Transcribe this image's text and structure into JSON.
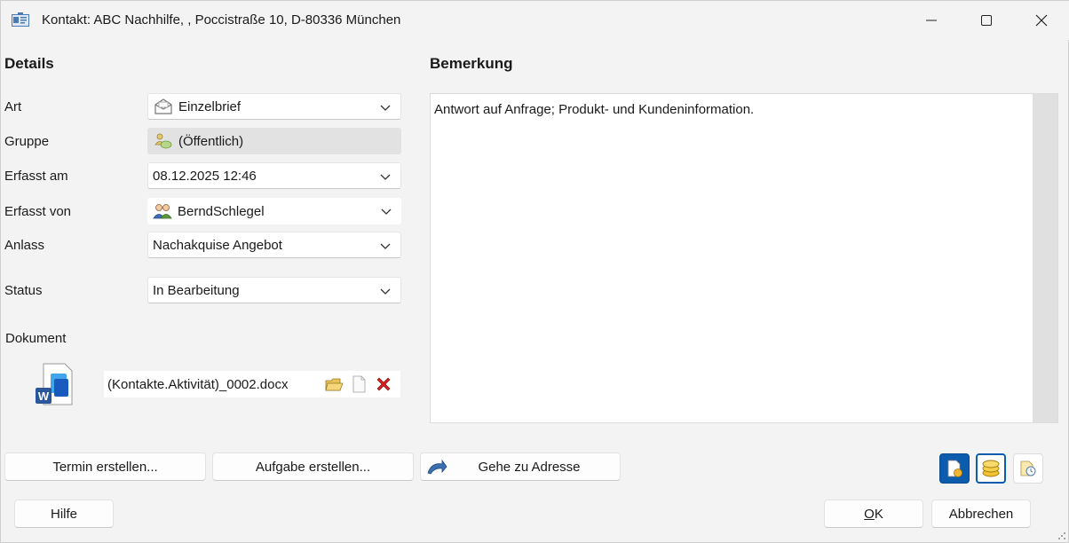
{
  "window": {
    "title": "Kontakt: ABC Nachhilfe,  , Poccistraße 10, D-80336 München",
    "minimize_glyph": "—",
    "maximize_glyph": "☐",
    "close_glyph": "✕"
  },
  "details": {
    "title": "Details",
    "fields": {
      "art": {
        "label": "Art",
        "value": "Einzelbrief",
        "icon": "envelope-icon"
      },
      "gruppe": {
        "label": "Gruppe",
        "value": "(Öffentlich)",
        "icon": "group-public-icon"
      },
      "erfasst_am": {
        "label": "Erfasst am",
        "value": "08.12.2025 12:46"
      },
      "erfasst_von": {
        "label": "Erfasst von",
        "value": "BerndSchlegel",
        "icon": "users-icon"
      },
      "anlass": {
        "label": "Anlass",
        "value": "Nachakquise Angebot"
      },
      "status": {
        "label": "Status",
        "value": "In Bearbeitung"
      }
    },
    "dokument": {
      "label": "Dokument",
      "file_name": "(Kontakte.Aktivität)_0002.docx",
      "icon": "word-document-icon"
    }
  },
  "bemerkung": {
    "title": "Bemerkung",
    "text": "Antwort auf Anfrage; Produkt- und Kundeninformation."
  },
  "actions": {
    "termin": "Termin erstellen...",
    "aufgabe": "Aufgabe erstellen...",
    "gehe_zu": "Gehe zu Adresse"
  },
  "footer": {
    "hilfe": "Hilfe",
    "ok_first": "O",
    "ok_rest": "K",
    "abbrechen": "Abbrechen"
  },
  "colors": {
    "accent": "#0b5cad",
    "delete": "#d21f1f",
    "folder": "#e8c25a"
  }
}
